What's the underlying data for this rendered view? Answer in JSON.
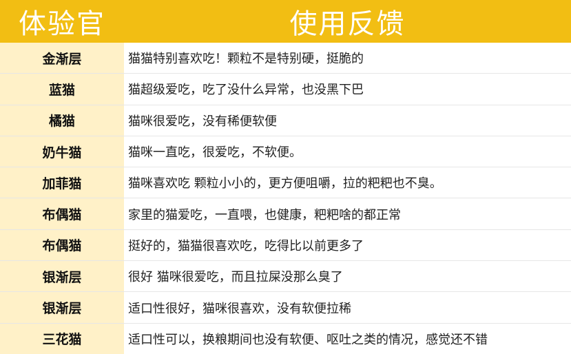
{
  "header": {
    "tester_label": "体验官",
    "feedback_label": "使用反馈"
  },
  "colors": {
    "header_bg": "#f2be13",
    "name_bg": "#fff1c8"
  },
  "rows": [
    {
      "name": "金渐层",
      "comment": "猫猫特别喜欢吃！颗粒不是特别硬，挺脆的"
    },
    {
      "name": "蓝猫",
      "comment": "猫超级爱吃，吃了没什么异常，也没黑下巴"
    },
    {
      "name": "橘猫",
      "comment": "猫咪很爱吃，没有稀便软便"
    },
    {
      "name": "奶牛猫",
      "comment": "猫咪一直吃，很爱吃，不软便。"
    },
    {
      "name": "加菲猫",
      "comment": "猫咪喜欢吃  颗粒小小的，更方便咀嚼，拉的粑粑也不臭。"
    },
    {
      "name": "布偶猫",
      "comment": "家里的猫爱吃，一直喂，也健康，粑粑啥的都正常"
    },
    {
      "name": "布偶猫",
      "comment": "挺好的，猫猫很喜欢吃，吃得比以前更多了"
    },
    {
      "name": "银渐层",
      "comment": "很好  猫咪很爱吃，而且拉屎没那么臭了"
    },
    {
      "name": "银渐层",
      "comment": "适口性很好，猫咪很喜欢，没有软便拉稀"
    },
    {
      "name": "三花猫",
      "comment": "适口性可以，换粮期间也没有软便、呕吐之类的情况，感觉还不错"
    }
  ]
}
